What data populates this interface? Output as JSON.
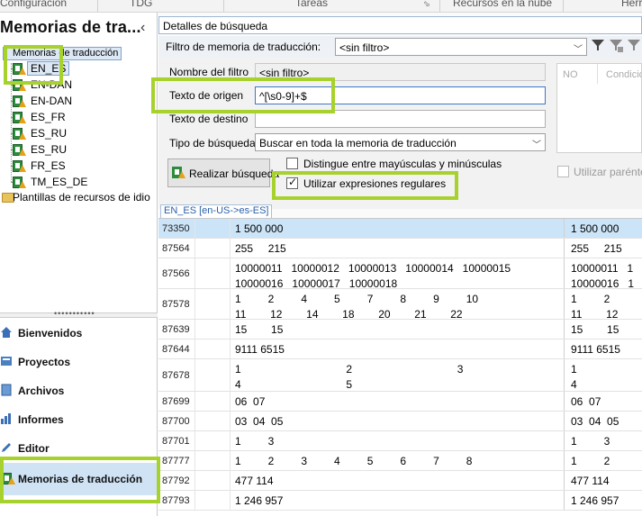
{
  "ribbon_tabs": [
    "Configuración",
    "TDG",
    "Tareas",
    "Recursos en la nube",
    "Herr"
  ],
  "left_panel": {
    "title": "Memorias de tra...",
    "collapse_icon": "chevron-left-icon",
    "tree_root": "Memorias de traducción",
    "tree_items": [
      "EN_ES",
      "EN-DAN",
      "EN-DAN",
      "ES_FR",
      "ES_RU",
      "ES_RU",
      "FR_ES",
      "TM_ES_DE"
    ],
    "templates_label": "Plantillas de recursos de idio",
    "splitter_dots": "•••••••••••"
  },
  "nav": {
    "items": [
      {
        "label": "Bienvenidos",
        "icon": "home-icon"
      },
      {
        "label": "Proyectos",
        "icon": "projects-icon"
      },
      {
        "label": "Archivos",
        "icon": "files-icon"
      },
      {
        "label": "Informes",
        "icon": "reports-icon"
      },
      {
        "label": "Editor",
        "icon": "pencil-icon"
      },
      {
        "label": "Memorias de traducción",
        "icon": "translation-memory-icon",
        "active": true
      }
    ]
  },
  "search": {
    "panel_title": "Detalles de búsqueda",
    "filter_label": "Filtro de memoria de traducción:",
    "filter_value": "<sin filtro>",
    "filter_name_label": "Nombre del filtro",
    "filter_name_value": "<sin filtro>",
    "source_label": "Texto de origen",
    "source_value": "^[\\s0-9]+$",
    "target_label": "Texto de destino",
    "target_value": "",
    "search_type_label": "Tipo de búsqueda",
    "search_type_value": "Buscar en toda la memoria de traducción",
    "search_button": "Realizar búsqueda",
    "case_sensitive_label": "Distingue entre mayúsculas y minúsculas",
    "case_sensitive_checked": false,
    "regex_label": "Utilizar expresiones regulares",
    "regex_checked": true,
    "side_grid_headers": [
      "NO",
      "Condicio"
    ],
    "use_parent_label": "Utilizar parénte",
    "use_parent_checked": false
  },
  "results": {
    "tab_label": "EN_ES [en-US->es-ES]",
    "rows": [
      {
        "id": "73350",
        "source": "1 500 000",
        "target": "1 500 000"
      },
      {
        "id": "87564",
        "source": "255     215",
        "target": "255     215"
      },
      {
        "id": "87566",
        "source": "10000011   10000012   10000013   10000014   10000015\n10000016   10000017   10000018",
        "target": "10000011   1\n10000016   1"
      },
      {
        "id": "87578",
        "source": "1         2         4         5         7         8         9         10\n11        12        14        18        20        21        22",
        "target": "1         2\n11        12"
      },
      {
        "id": "87639",
        "source": "15        15",
        "target": "15        15"
      },
      {
        "id": "87644",
        "source": "9111 6515",
        "target": "9111 6515"
      },
      {
        "id": "87678",
        "source": "1                                   2                                   3\n4                                   5",
        "target": "1\n4"
      },
      {
        "id": "87699",
        "source": "06  07",
        "target": "06  07"
      },
      {
        "id": "87700",
        "source": "03  04  05",
        "target": "03  04  05"
      },
      {
        "id": "87701",
        "source": "1         3",
        "target": "1         3"
      },
      {
        "id": "87777",
        "source": "1         2         3         4         5         6         7         8",
        "target": "1         2"
      },
      {
        "id": "87792",
        "source": "477 114",
        "target": "477 114"
      },
      {
        "id": "87793",
        "source": "1 246 957",
        "target": "1 246 957"
      }
    ]
  },
  "colors": {
    "highlight": "#a7d22d",
    "selection": "#cce4f7",
    "accent": "#2b5fa8"
  }
}
